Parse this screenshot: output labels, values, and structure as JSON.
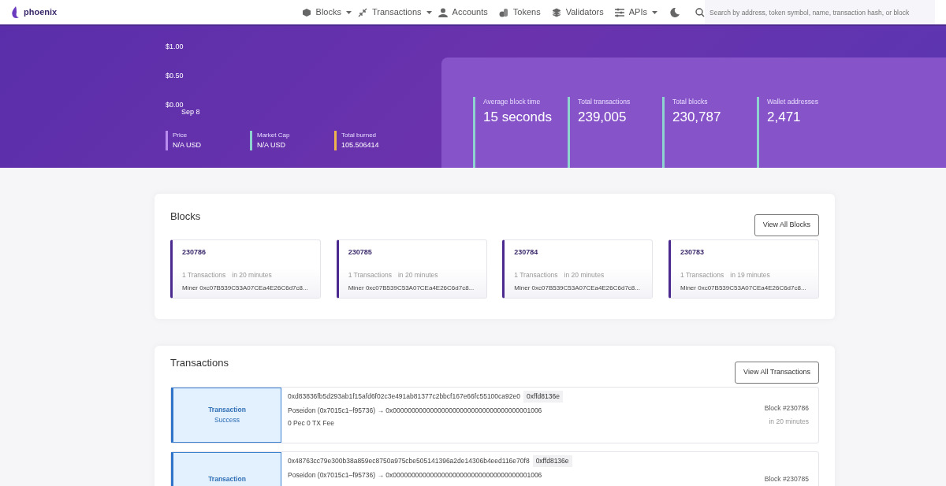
{
  "brand": "phoenix",
  "nav": [
    {
      "label": "Blocks",
      "dropdown": true
    },
    {
      "label": "Transactions",
      "dropdown": true
    },
    {
      "label": "Accounts",
      "dropdown": false
    },
    {
      "label": "Tokens",
      "dropdown": false
    },
    {
      "label": "Validators",
      "dropdown": false
    },
    {
      "label": "APIs",
      "dropdown": true
    }
  ],
  "search": {
    "placeholder": "Search by address, token symbol, name, transaction hash, or block"
  },
  "price_chart": {
    "y_labels": [
      "$1.00",
      "$0.50",
      "$0.00"
    ],
    "x_labels": [
      "Sep 8"
    ]
  },
  "market": [
    {
      "label": "Price",
      "value": "N/A USD",
      "color": "#b98cf0"
    },
    {
      "label": "Market Cap",
      "value": "N/A USD",
      "color": "#8fd3d0"
    },
    {
      "label": "Total burned",
      "value": "105.506414",
      "color": "#f0b44c"
    }
  ],
  "stats": [
    {
      "label": "Average block time",
      "value": "15 seconds"
    },
    {
      "label": "Total transactions",
      "value": "239,005"
    },
    {
      "label": "Total blocks",
      "value": "230,787"
    },
    {
      "label": "Wallet addresses",
      "value": "2,471"
    }
  ],
  "blocks": {
    "title": "Blocks",
    "button": "View All Blocks",
    "items": [
      {
        "number": "230786",
        "txs": "1 Transactions",
        "time": "in 20 minutes",
        "miner": "Miner 0xc07B539C53A07CEa4E26C6d7c8..."
      },
      {
        "number": "230785",
        "txs": "1 Transactions",
        "time": "in 20 minutes",
        "miner": "Miner 0xc07B539C53A07CEa4E26C6d7c8..."
      },
      {
        "number": "230784",
        "txs": "1 Transactions",
        "time": "in 20 minutes",
        "miner": "Miner 0xc07B539C53A07CEa4E26C6d7c8..."
      },
      {
        "number": "230783",
        "txs": "1 Transactions",
        "time": "in 19 minutes",
        "miner": "Miner 0xc07B539C53A07CEa4E26C6d7c8..."
      }
    ]
  },
  "transactions": {
    "title": "Transactions",
    "button": "View All Transactions",
    "items": [
      {
        "type": "Transaction",
        "status": "Success",
        "hash": "0xd83836fb5d293ab1f15afd6f02c3e491ab81377c2bbcf167e66fc55100ca92e0",
        "method": "0xffd8136e",
        "route": "Poseidon (0x7015c1–f95736) → 0x0000000000000000000000000000000000001006",
        "fee": "0 Pec 0 TX Fee",
        "block": "Block #230786",
        "time": "in 20 minutes"
      },
      {
        "type": "Transaction",
        "hash": "0x48763cc79e300b38a859ec8750a975cbe505141396a2de14306b4eed116e70f8",
        "method": "0xffd8136e",
        "route": "Poseidon (0x7015c1–f95736) → 0x0000000000000000000000000000000000001006",
        "block": "Block #230785"
      }
    ]
  }
}
